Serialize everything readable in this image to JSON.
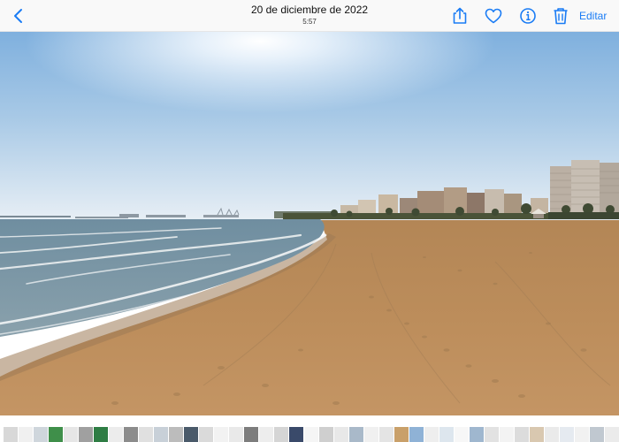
{
  "header": {
    "date": "20 de diciembre de 2022",
    "time": "5:57",
    "edit_label": "Editar",
    "accent_color": "#1a7cf5"
  },
  "toolbar_icons": [
    "back-chevron-icon",
    "share-icon",
    "heart-icon",
    "info-icon",
    "trash-icon"
  ],
  "photo": {
    "subject": "beach",
    "sky_colors": [
      "#f4f8fb",
      "#9cc2e6",
      "#6fa3d6"
    ],
    "sand_color": "#b98a56",
    "water_color": "#7a96a6"
  },
  "filmstrip": {
    "thumb_colors": [
      "#d8d8d8",
      "#f0f0f0",
      "#cfd6dc",
      "#3f8f4a",
      "#e6e6e6",
      "#a0a0a0",
      "#2e7d44",
      "#ececec",
      "#8c8c8c",
      "#e0e0e0",
      "#c8d0d8",
      "#bcbcbc",
      "#4a5a6a",
      "#dadada",
      "#f2f2f2",
      "#e9e9e9",
      "#7d7d7d",
      "#ededed",
      "#d5d5d5",
      "#3a4a6a",
      "#f5f5f5",
      "#cfcfcf",
      "#e8e8e8",
      "#a9b9c9",
      "#f0f0f0",
      "#e4e4e4",
      "#c9a06a",
      "#8fb2d6",
      "#eeeeee",
      "#dde6ee",
      "#f7f7f7",
      "#9fb7cf",
      "#e2e2e2",
      "#f3f3f3",
      "#dcdcdc",
      "#d9c8b0",
      "#eaeaea",
      "#e5eaf0",
      "#f1f1f1",
      "#c0c8d0",
      "#ebebeb",
      "#f6f6f6"
    ]
  }
}
